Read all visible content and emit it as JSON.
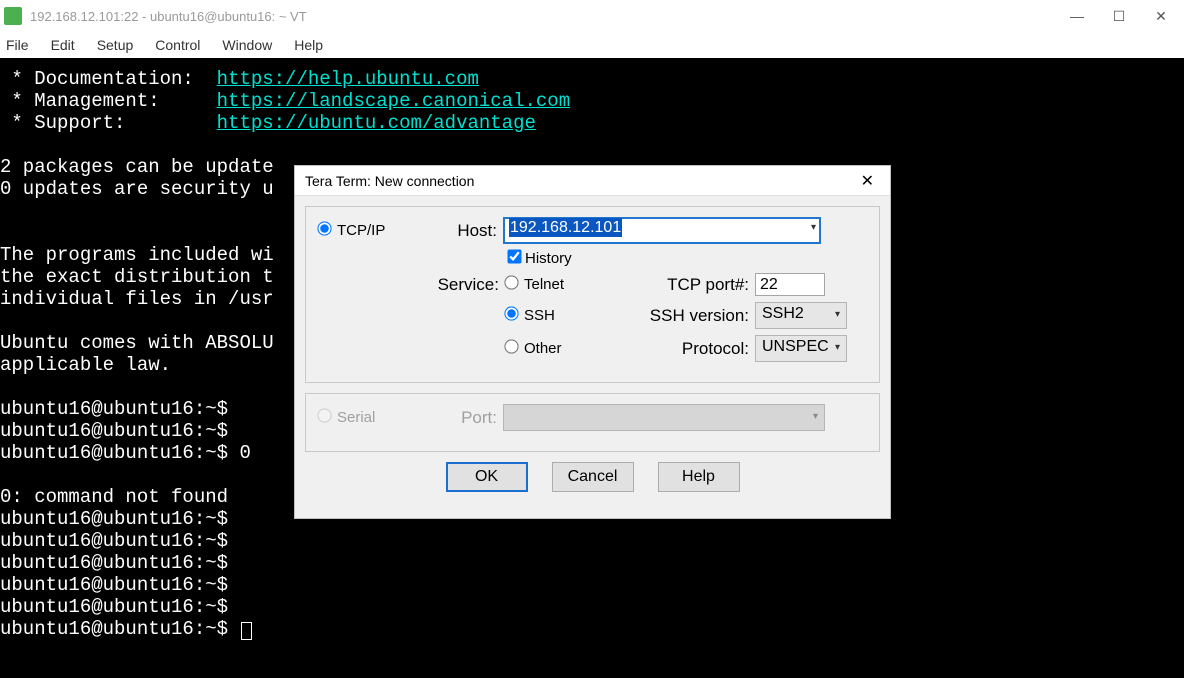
{
  "window": {
    "title": "192.168.12.101:22 - ubuntu16@ubuntu16: ~ VT"
  },
  "menubar": [
    "File",
    "Edit",
    "Setup",
    "Control",
    "Window",
    "Help"
  ],
  "terminal": {
    "doc_label": " * Documentation:  ",
    "doc_url": "https://help.ubuntu.com",
    "mgmt_label": " * Management:     ",
    "mgmt_url": "https://landscape.canonical.com",
    "sup_label": " * Support:        ",
    "sup_url": "https://ubuntu.com/advantage",
    "line5": "2 packages can be update",
    "line6": "0 updates are security u",
    "line7": "The programs included wi",
    "line8": "the exact distribution t",
    "line9": "individual files in /usr",
    "line10": "Ubuntu comes with ABSOLU",
    "line11": "applicable law.",
    "prompt": "ubuntu16@ubuntu16:~$",
    "prompt_zero": "ubuntu16@ubuntu16:~$ 0",
    "cmd_not_found": "0: command not found"
  },
  "dialog": {
    "title": "Tera Term: New connection",
    "tcpip": "TCP/IP",
    "host_label": "Host:",
    "host_value": "192.168.12.101",
    "history": "History",
    "service_label": "Service:",
    "telnet": "Telnet",
    "ssh": "SSH",
    "other": "Other",
    "tcpport_label": "TCP port#:",
    "tcpport_value": "22",
    "sshver_label": "SSH version:",
    "sshver_value": "SSH2",
    "protocol_label": "Protocol:",
    "protocol_value": "UNSPEC",
    "serial": "Serial",
    "port_label": "Port:",
    "ok": "OK",
    "cancel": "Cancel",
    "help": "Help"
  }
}
